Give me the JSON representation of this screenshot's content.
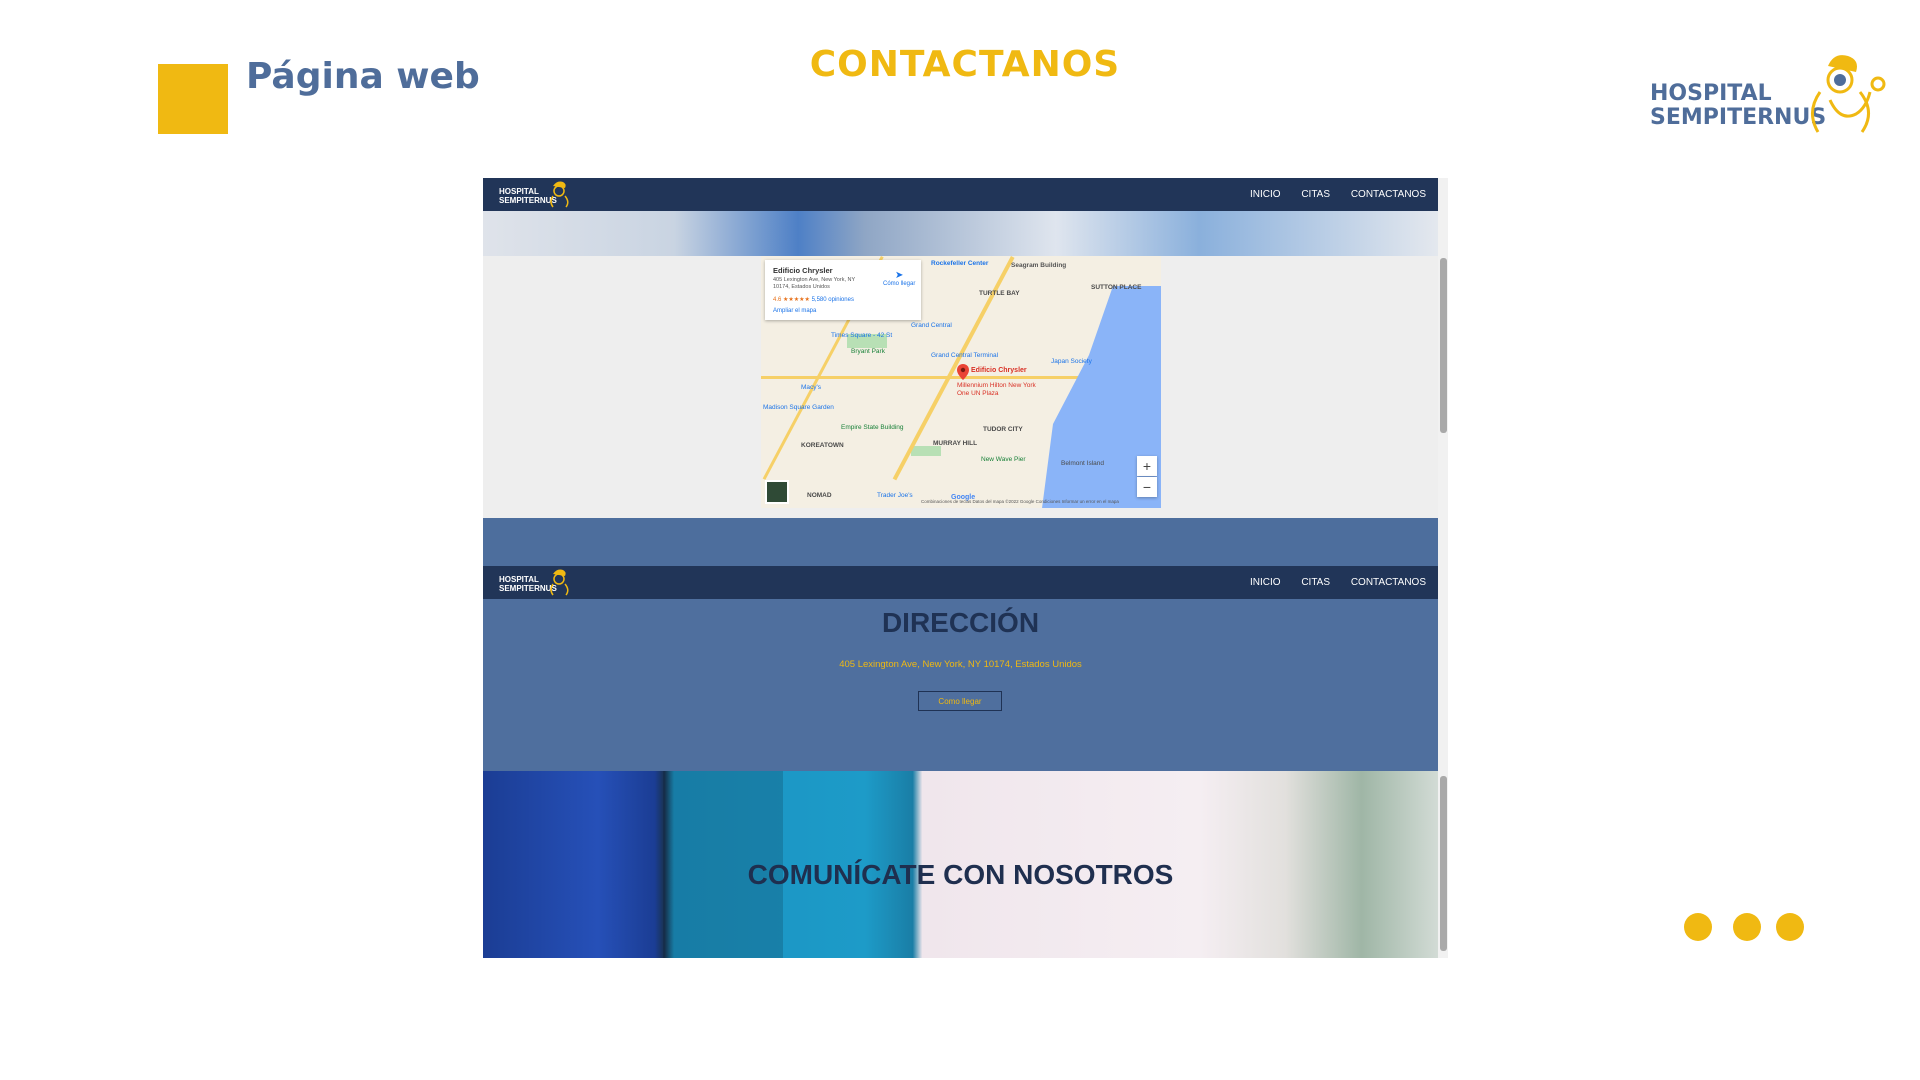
{
  "slide": {
    "subtitle": "Página web",
    "title": "CONTACTANOS",
    "logo_text_line1": "HOSPITAL",
    "logo_text_line2": "SEMPITERNUS",
    "accent_color": "#f0b912",
    "brand_color": "#4f6d9a"
  },
  "site": {
    "brand_line1": "HOSPITAL",
    "brand_line2": "SEMPITERNUS",
    "nav": [
      "INICIO",
      "CITAS",
      "CONTACTANOS"
    ],
    "nav_color": "#213558"
  },
  "map": {
    "place_name": "Edificio Chrysler",
    "place_address": "405 Lexington Ave, New York, NY 10174, Estados Unidos",
    "rating": "4.6 ★★★★★",
    "reviews": "5,580 opiniones",
    "directions": "Cómo llegar",
    "enlarge": "Ampliar el mapa",
    "pin_label": "Edificio Chrysler",
    "labels": [
      "Rockefeller Center",
      "Seagram Building",
      "TURTLE BAY",
      "SUTTON PLACE",
      "Grand Central",
      "Times Square - 42 St",
      "Bryant Park",
      "Grand Central Terminal",
      "Japan Society",
      "Macy's",
      "Millennium Hilton New York One UN Plaza",
      "Madison Square Garden",
      "Empire State Building",
      "TUDOR CITY",
      "KOREATOWN",
      "MURRAY HILL",
      "New Wave Pier",
      "Belmont Island",
      "NOMAD",
      "Trader Joe's",
      "Google"
    ],
    "zoom_in": "+",
    "zoom_out": "−",
    "attribution": "Combinaciones de teclas   Datos del mapa ©2022 Google   Condiciones   Informar un error en el mapa"
  },
  "direccion": {
    "title": "DIRECCIÓN",
    "address": "405 Lexington Ave, New York, NY 10174, Estados Unidos",
    "button": "Como llegar"
  },
  "comunicate": {
    "title": "COMUNÍCATE CON NOSOTROS"
  }
}
